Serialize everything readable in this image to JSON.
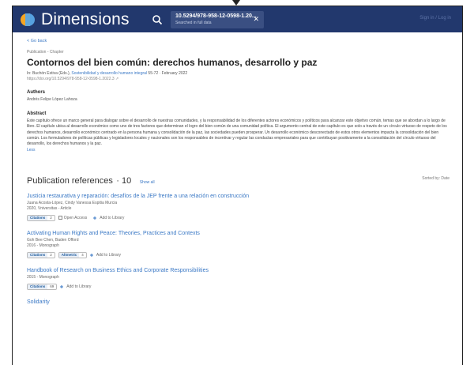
{
  "header": {
    "logo_text": "Dimensions",
    "search_chip_main": "10.5294/978-958-12-0598-1.20...",
    "search_chip_sub": "Searched in full data",
    "signin": "Sign in / Log in"
  },
  "page": {
    "back_link": "< Go back",
    "pub_type": "Publication - Chapter",
    "title": "Contornos del bien común: derechos humanos, desarrollo y paz",
    "meta_prefix": "In: Buchón Estiva (Eds.), ",
    "meta_book": "Sostenibilidad y desarrollo humano integral",
    "meta_suffix": " 55-72 · February 2022",
    "doi": "https://doi.org/10.5294/978-958-12-0598-1.2022.3 ↗",
    "authors_heading": "Authors",
    "authors": "Andrés Felipe López Lahoza",
    "abstract_heading": "Abstract",
    "abstract_text": "Este capítulo ofrece un marco general para dialogar sobre el desarrollo de nuestras comunidades, y la responsabilidad de los diferentes actores económicos y políticos para alcanzar este objetivo común, temas que se abordan a lo largo de libro. El capítulo ubica al desarrollo económico como uno de tres factores que determinan el logro del bien común de una comunidad política. El argumento central de este capítulo es que solo a través de un círculo virtuoso de respeto de los derechos humanos, desarrollo económico centrado en la persona humana y consolidación de la paz, las sociedades pueden prosperar. Un desarrollo económico desconectado de estos otros elementos impacta la consolidación del bien común. Los formuladores de políticas públicas y legisladores locales y nacionales son los responsables de incentivar y regular las conductas empresariales para que contribuyan positivamente a la consolidación del círculo virtuoso del desarrollo, los derechos humanos y la paz.",
    "less_link": "Less"
  },
  "references": {
    "title": "Publication references",
    "count": "· 10",
    "show_all": "Show all",
    "sorted": "Sorted by: Date",
    "items": [
      {
        "title": "Justicia restaurativa y reparación: desafíos de la JEP frente a una relación en construcción",
        "authors": "Juana Acosta-López, Cindy Vanessa Espitia Murcia",
        "info": "2020, Vniversitas - Article",
        "badge_label": "Citations",
        "badge_num": "2",
        "open_access": "Open Access",
        "add_library": "Add to Library"
      },
      {
        "title": "Activating Human Rights and Peace: Theories, Practices and Contexts",
        "authors": "Goh Bee Chen, Baden Offord",
        "info": "2016 - Monograph",
        "badge_label": "Citations",
        "badge_num": "2",
        "badge2_label": "Altmetric",
        "badge2_num": "4",
        "add_library": "Add to Library"
      },
      {
        "title": "Handbook of Research on Business Ethics and Corporate Responsibilities",
        "info": "2015 - Monograph",
        "badge_label": "Citations",
        "badge_num": "69",
        "add_library": "Add to Library"
      },
      {
        "title": "Solidarity"
      }
    ]
  },
  "colors": {
    "header_bg": "#22386d",
    "link": "#3a78c5",
    "logo_orange": "#f6a623",
    "logo_blue": "#5aa7e6"
  }
}
